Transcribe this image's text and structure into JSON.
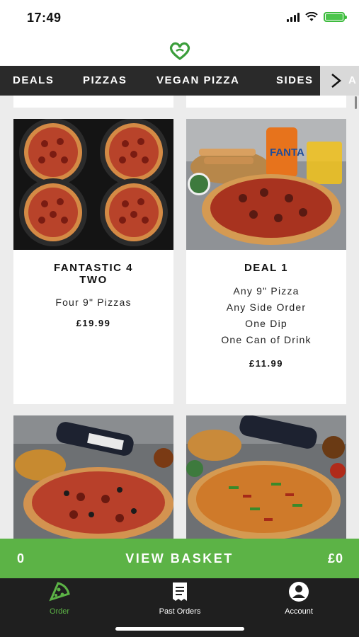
{
  "status_bar": {
    "time": "17:49"
  },
  "header": {
    "logo_icon": "leaf-heart-logo"
  },
  "categories": {
    "tabs": [
      {
        "label": "DEALS"
      },
      {
        "label": "PIZZAS"
      },
      {
        "label": "VEGAN PIZZA"
      },
      {
        "label": "SIDES"
      }
    ],
    "partial_next": "A",
    "next_icon": "chevron-right-icon"
  },
  "products": [
    {
      "title": "FANTASTIC 4\nTWO",
      "lines": [
        "Four 9\" Pizzas"
      ],
      "price": "£19.99"
    },
    {
      "title": "DEAL 1",
      "lines": [
        "Any 9\" Pizza",
        "Any Side Order",
        "One Dip",
        "One Can of Drink"
      ],
      "price": "£11.99"
    }
  ],
  "basket": {
    "count": "0",
    "label": "VIEW BASKET",
    "total": "£0"
  },
  "bottom_nav": [
    {
      "label": "Order",
      "icon": "pizza-slice-icon"
    },
    {
      "label": "Past Orders",
      "icon": "receipt-icon"
    },
    {
      "label": "Account",
      "icon": "user-icon"
    }
  ],
  "colors": {
    "brand_green": "#5cb346",
    "nav_dark": "#2a2a2a",
    "bottom_dark": "#1f1f1f"
  }
}
